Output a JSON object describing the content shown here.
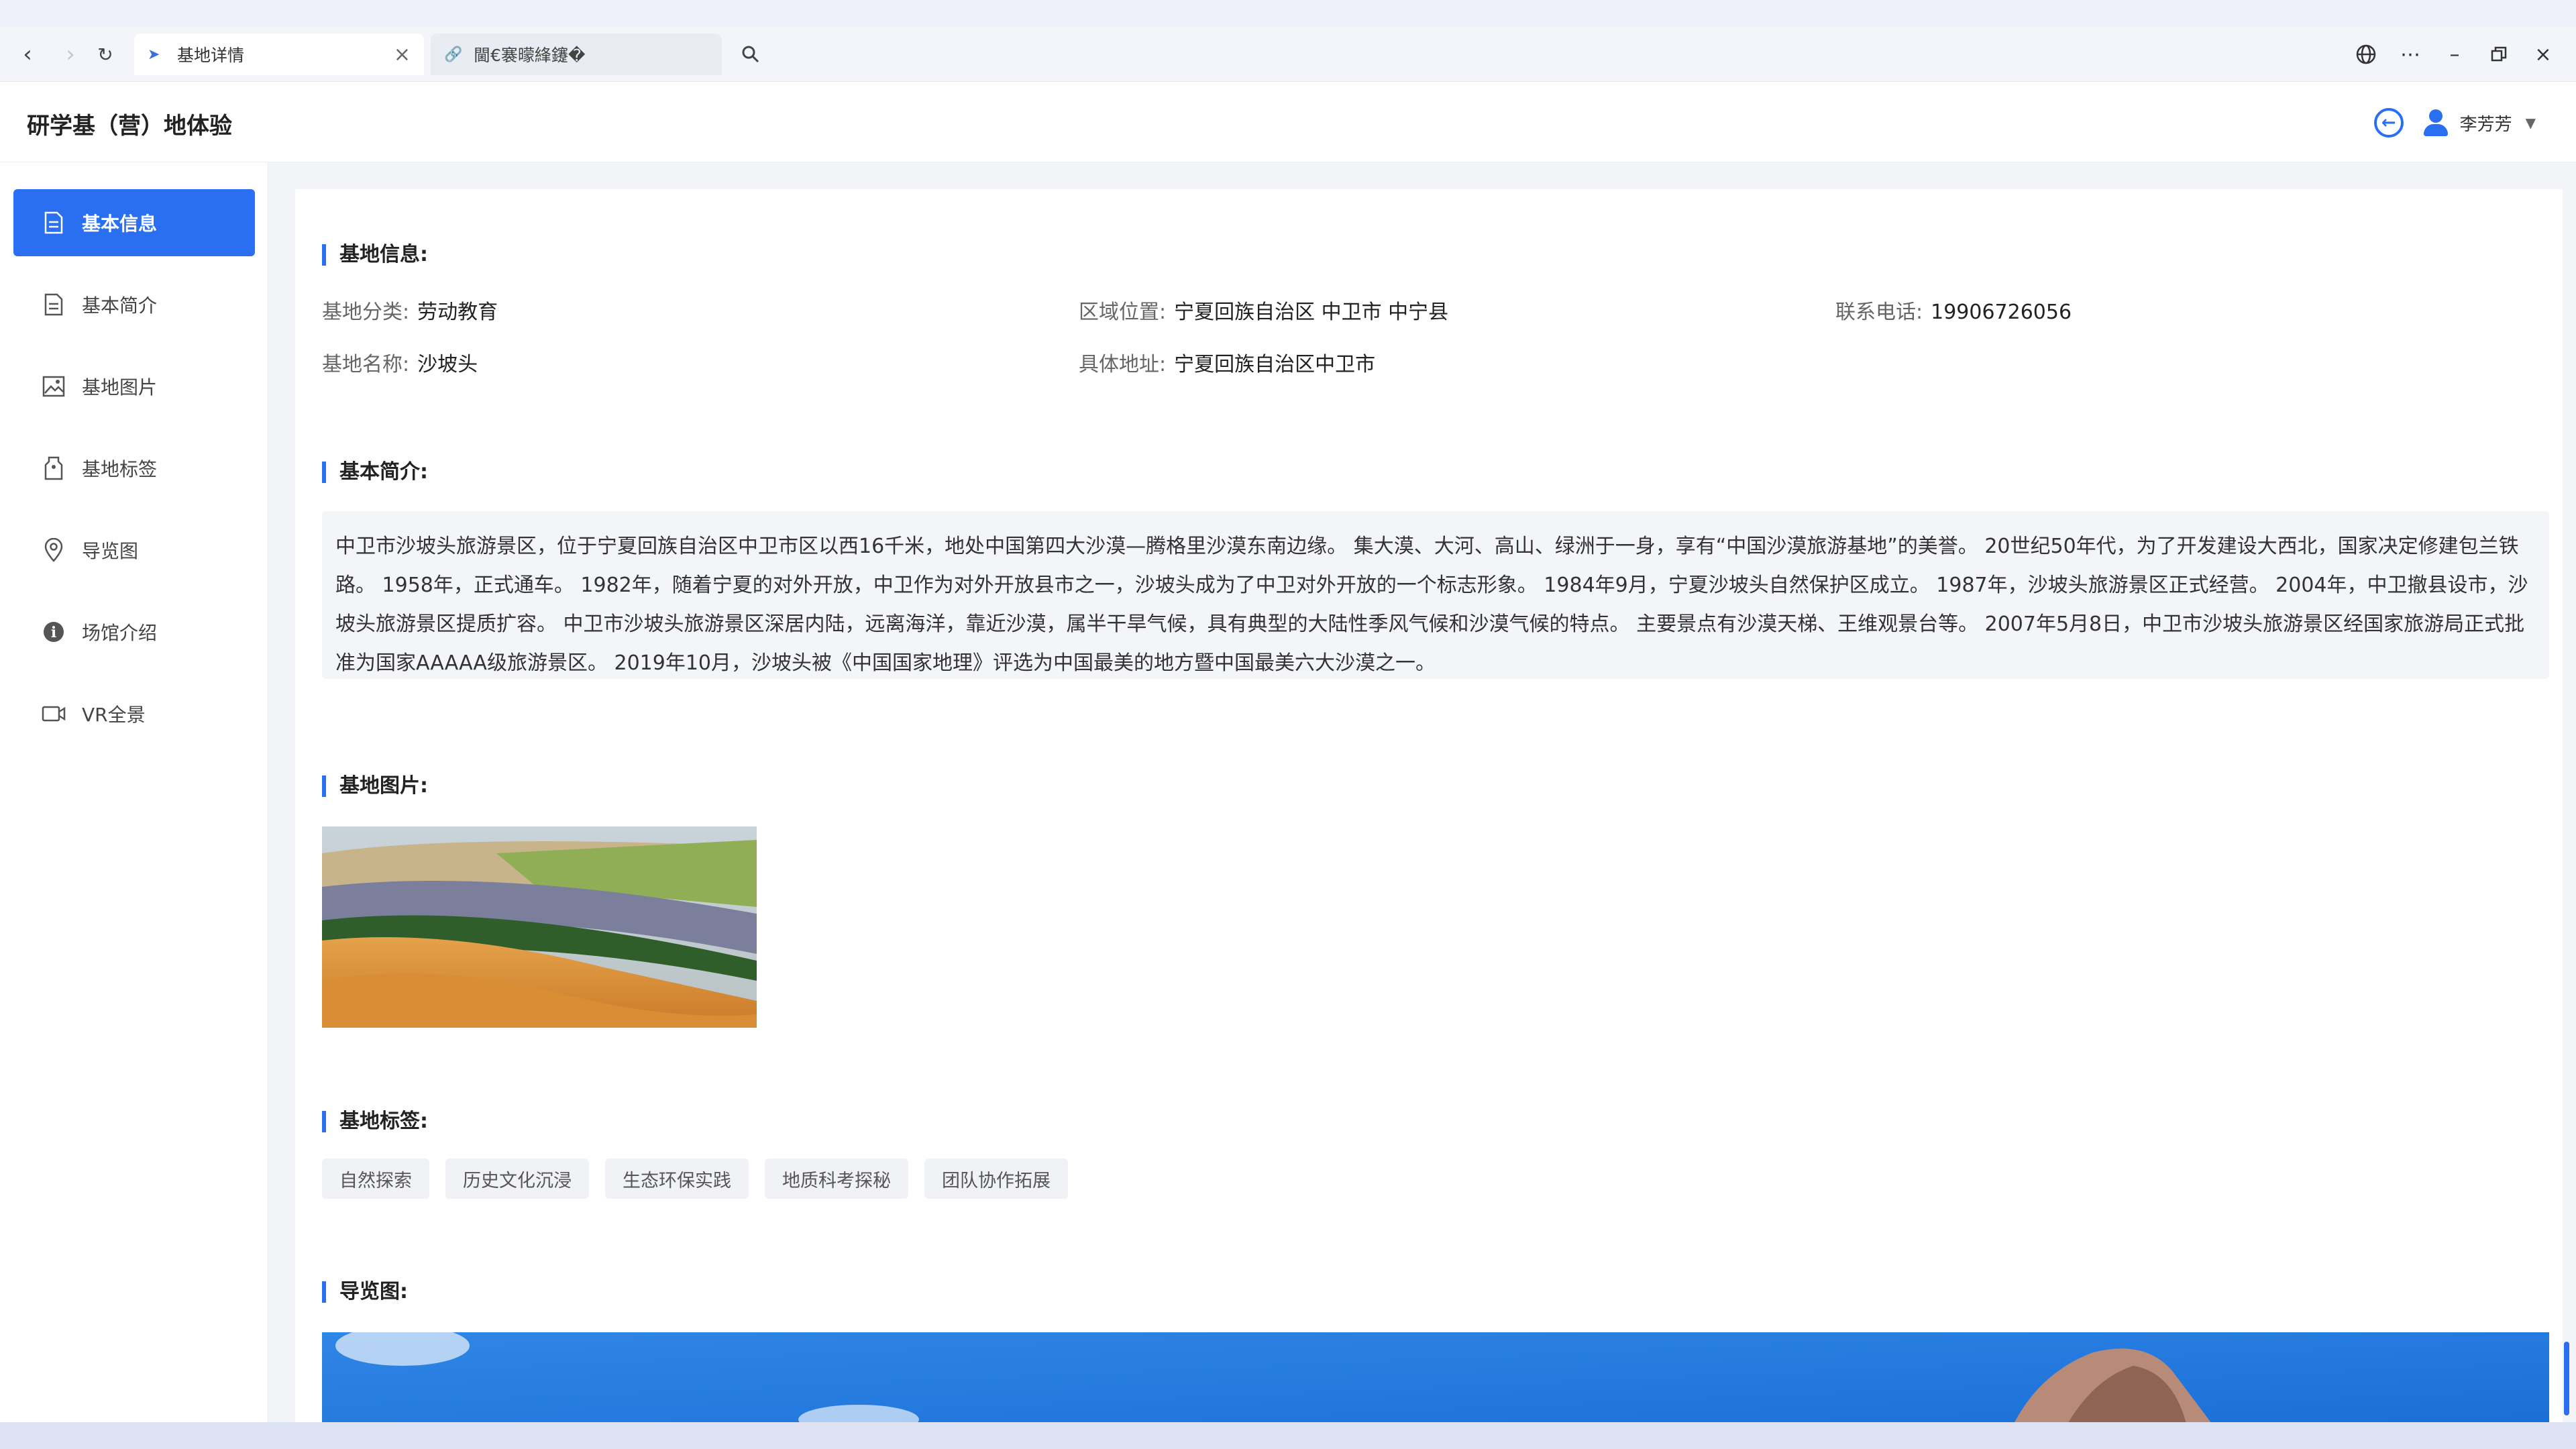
{
  "browser": {
    "tabs": [
      {
        "title": "基地详情",
        "active": true,
        "icon": "app-logo-icon"
      },
      {
        "title": "閫€褰曚綘鑳�",
        "active": false,
        "icon": "link-icon"
      }
    ],
    "icons": [
      "back-icon",
      "forward-icon",
      "reload-icon",
      "search-icon",
      "globe-icon",
      "more-icon",
      "minimize-icon",
      "restore-icon",
      "close-icon"
    ]
  },
  "header": {
    "title": "研学基（营）地体验",
    "user_name": "李芳芳"
  },
  "sidebar": {
    "items": [
      {
        "label": "基本信息",
        "icon": "document-icon",
        "active": true
      },
      {
        "label": "基本简介",
        "icon": "document-icon",
        "active": false
      },
      {
        "label": "基地图片",
        "icon": "image-icon",
        "active": false
      },
      {
        "label": "基地标签",
        "icon": "tag-icon",
        "active": false
      },
      {
        "label": "导览图",
        "icon": "location-pin-icon",
        "active": false
      },
      {
        "label": "场馆介绍",
        "icon": "info-icon",
        "active": false
      },
      {
        "label": "VR全景",
        "icon": "video-icon",
        "active": false
      }
    ]
  },
  "info": {
    "section_title": "基地信息:",
    "category_label": "基地分类:",
    "category_value": "劳动教育",
    "region_label": "区域位置:",
    "region_value": "宁夏回族自治区 中卫市 中宁县",
    "phone_label": "联系电话:",
    "phone_value": "19906726056",
    "name_label": "基地名称:",
    "name_value": "沙坡头",
    "address_label": "具体地址:",
    "address_value": "宁夏回族自治区中卫市"
  },
  "intro": {
    "section_title": "基本简介:",
    "text": "中卫市沙坡头旅游景区，位于宁夏回族自治区中卫市区以西16千米，地处中国第四大沙漠—腾格里沙漠东南边缘。 集大漠、大河、高山、绿洲于一身，享有“中国沙漠旅游基地”的美誉。 20世纪50年代，为了开发建设大西北，国家决定修建包兰铁路。 1958年，正式通车。 1982年，随着宁夏的对外开放，中卫作为对外开放县市之一，沙坡头成为了中卫对外开放的一个标志形象。 1984年9月，宁夏沙坡头自然保护区成立。 1987年，沙坡头旅游景区正式经营。 2004年，中卫撤县设市，沙坡头旅游景区提质扩容。 中卫市沙坡头旅游景区深居内陆，远离海洋，靠近沙漠，属半干旱气候，具有典型的大陆性季风气候和沙漠气候的特点。 主要景点有沙漠天梯、王维观景台等。 2007年5月8日，中卫市沙坡头旅游景区经国家旅游局正式批准为国家AAAAA级旅游景区。 2019年10月，沙坡头被《中国国家地理》评选为中国最美的地方暨中国最美六大沙漠之一。"
  },
  "photos": {
    "section_title": "基地图片:"
  },
  "tags": {
    "section_title": "基地标签:",
    "items": [
      "自然探索",
      "历史文化沉浸",
      "生态环保实践",
      "地质科考探秘",
      "团队协作拓展"
    ]
  },
  "guide": {
    "section_title": "导览图:"
  },
  "colors": {
    "accent": "#2a6ff2",
    "content_bg": "#f2f4f8",
    "tag_bg": "#f1f2f5"
  }
}
